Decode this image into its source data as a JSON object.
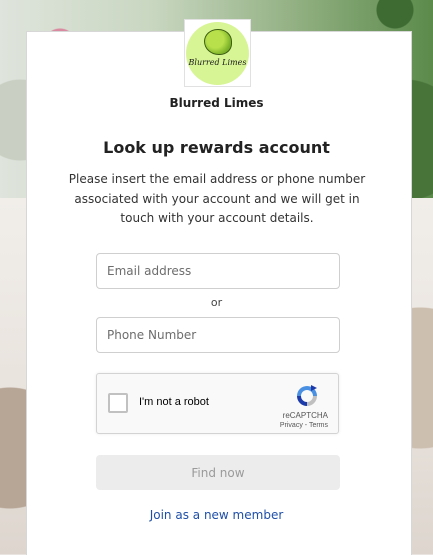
{
  "brand": {
    "name": "Blurred Limes",
    "logo_text": "Blurred Limes",
    "logo_color": "#d8f596"
  },
  "form": {
    "title": "Look up rewards account",
    "description": "Please insert the email address or phone number associated with your account and we will get in touch with your account details.",
    "email_placeholder": "Email address",
    "or_text": "or",
    "phone_placeholder": "Phone Number",
    "submit_label": "Find now"
  },
  "captcha": {
    "label": "I'm not a robot",
    "brand": "reCAPTCHA",
    "privacy": "Privacy",
    "separator": " - ",
    "terms": "Terms",
    "icon": "recaptcha-icon"
  },
  "footer": {
    "join_label": "Join as a new member",
    "link_color": "#1f4fa8"
  }
}
